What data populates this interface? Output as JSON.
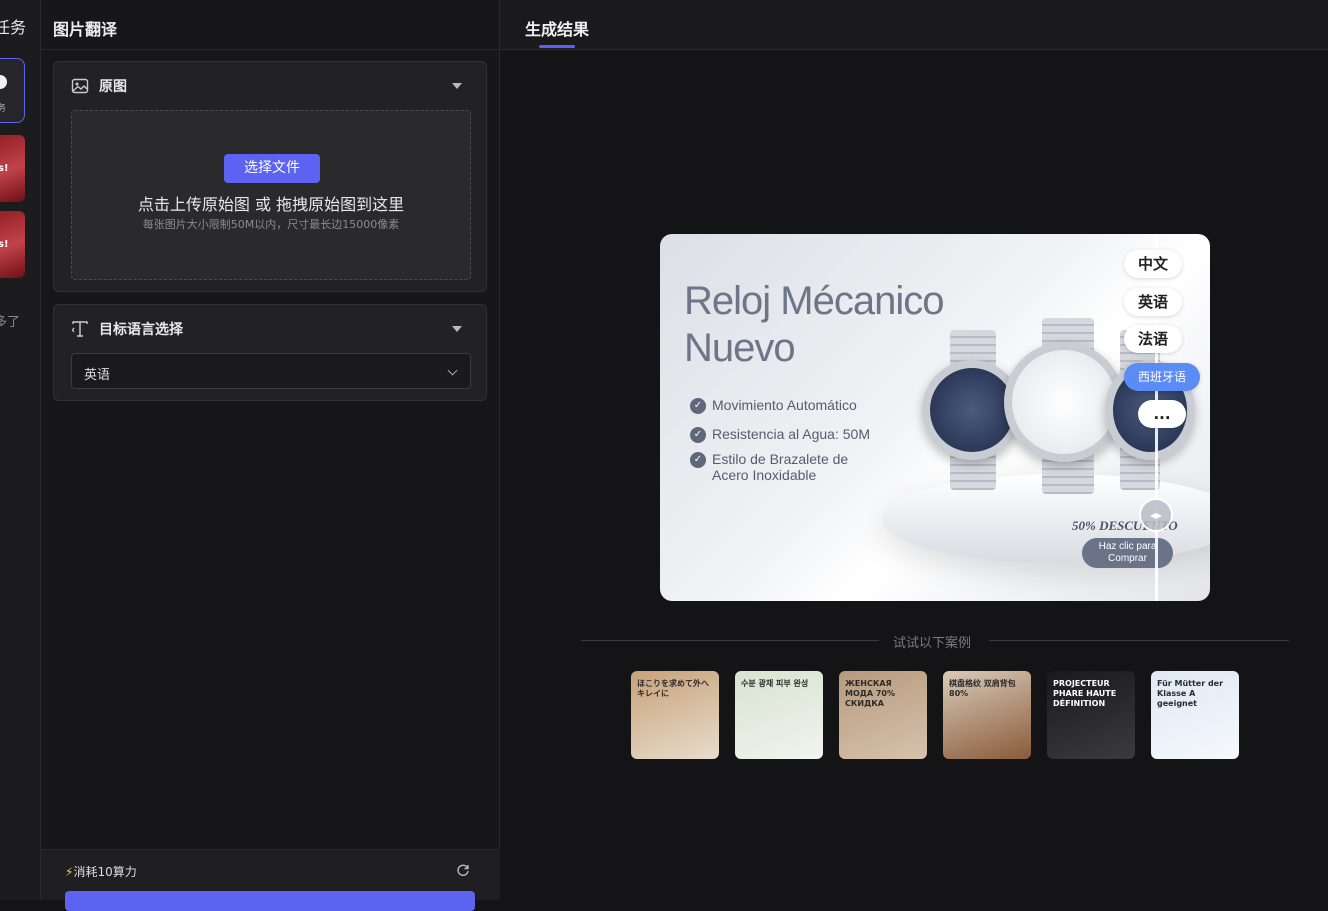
{
  "strip": {
    "title": "任务",
    "task_label": "务",
    "thumb_text": "s!",
    "more": "多了"
  },
  "left": {
    "header": "图片翻译",
    "original": {
      "title": "原图",
      "upload_button": "选择文件",
      "upload_main": "点击上传原始图 或 拖拽原始图到这里",
      "upload_sub": "每张图片大小限制50M以内，尺寸最长边15000像素"
    },
    "target": {
      "title": "目标语言选择",
      "selected": "英语"
    },
    "cost": "消耗10算力"
  },
  "right": {
    "tab": "生成结果",
    "preview": {
      "title_line1": "Reloj Mécanico",
      "title_line2": "Nuevo",
      "features": [
        "Movimiento Automático",
        "Resistencia al Agua: 50M",
        "Estilo de Brazalete de Acero Inoxidable"
      ],
      "discount": "50% DESCUENTO",
      "cta": "Haz clic para Comprar"
    },
    "languages": [
      "中文",
      "英语",
      "法语",
      "西班牙语",
      "..."
    ],
    "active_language_index": 3,
    "cases_label": "试试以下案例",
    "cases": [
      {
        "text": "ほこりを求めて外へキレイに",
        "colors": [
          "#c8a27a",
          "#e7dccb"
        ]
      },
      {
        "text": "수분 광채 피부 완성",
        "colors": [
          "#d7e3d0",
          "#f2f4ee"
        ]
      },
      {
        "text": "ЖЕНСКАЯ МОДА 70% СКИДКА",
        "colors": [
          "#b79a7d",
          "#d6c2ad"
        ]
      },
      {
        "text": "棋盘格纹 双肩背包 80%",
        "colors": [
          "#d9cbb8",
          "#8a5a3b"
        ]
      },
      {
        "text": "PROJECTEUR PHARE HAUTE DÉFINITION",
        "colors": [
          "#1a1a1c",
          "#3a3a40"
        ]
      },
      {
        "text": "Für Mütter der Klasse A geeignet",
        "colors": [
          "#dfe8f5",
          "#f6f9fd"
        ]
      }
    ],
    "accent": "#5b63f0"
  }
}
